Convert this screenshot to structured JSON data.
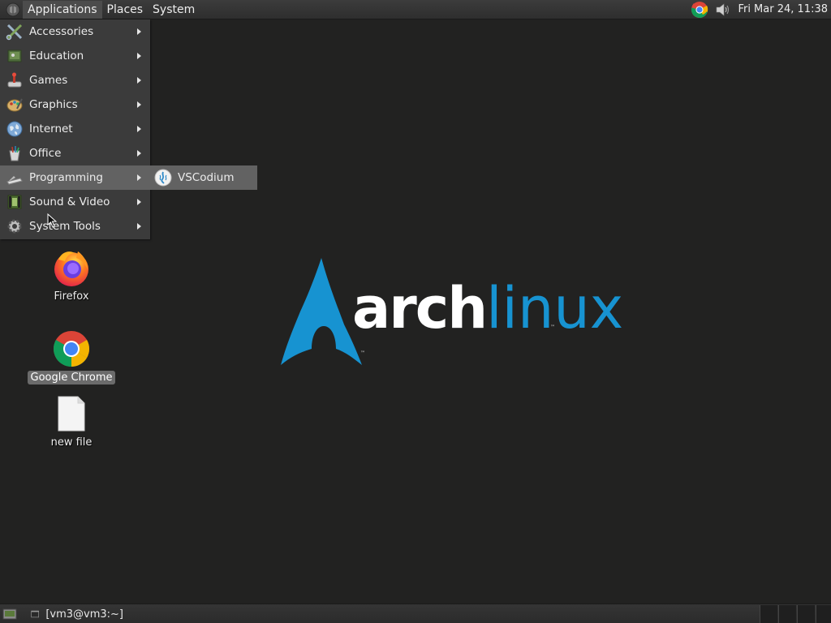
{
  "top_panel": {
    "menus": [
      {
        "label": "Applications",
        "active": true
      },
      {
        "label": "Places",
        "active": false
      },
      {
        "label": "System",
        "active": false
      }
    ],
    "clock": "Fri Mar 24, 11:38",
    "tray_icons": [
      "chrome-icon",
      "volume-icon"
    ]
  },
  "app_menu": {
    "items": [
      {
        "label": "Accessories",
        "icon": "accessories-icon",
        "has_submenu": true
      },
      {
        "label": "Education",
        "icon": "education-icon",
        "has_submenu": true
      },
      {
        "label": "Games",
        "icon": "games-icon",
        "has_submenu": true
      },
      {
        "label": "Graphics",
        "icon": "graphics-icon",
        "has_submenu": true
      },
      {
        "label": "Internet",
        "icon": "internet-icon",
        "has_submenu": true
      },
      {
        "label": "Office",
        "icon": "office-icon",
        "has_submenu": true
      },
      {
        "label": "Programming",
        "icon": "programming-icon",
        "has_submenu": true,
        "highlighted": true
      },
      {
        "label": "Sound & Video",
        "icon": "sound-video-icon",
        "has_submenu": true
      },
      {
        "label": "System Tools",
        "icon": "system-tools-icon",
        "has_submenu": true
      }
    ],
    "submenu": {
      "items": [
        {
          "label": "VSCodium",
          "icon": "vscodium-icon",
          "highlighted": true
        }
      ]
    }
  },
  "desktop": {
    "icons": [
      {
        "label": "Firefox",
        "icon": "firefox-icon",
        "selected": false
      },
      {
        "label": "Google Chrome",
        "icon": "chrome-icon",
        "selected": true
      },
      {
        "label": "new file",
        "icon": "file-icon",
        "selected": false
      }
    ],
    "wallpaper": {
      "word_1": "arch",
      "word_2": "linux",
      "trademark": "™",
      "colors": {
        "arch": "#ffffff",
        "linux": "#1793d1",
        "background": "#222221"
      }
    }
  },
  "bottom_panel": {
    "tasks": [
      {
        "label": "[vm3@vm3:~]",
        "icon": "terminal-icon"
      }
    ]
  }
}
